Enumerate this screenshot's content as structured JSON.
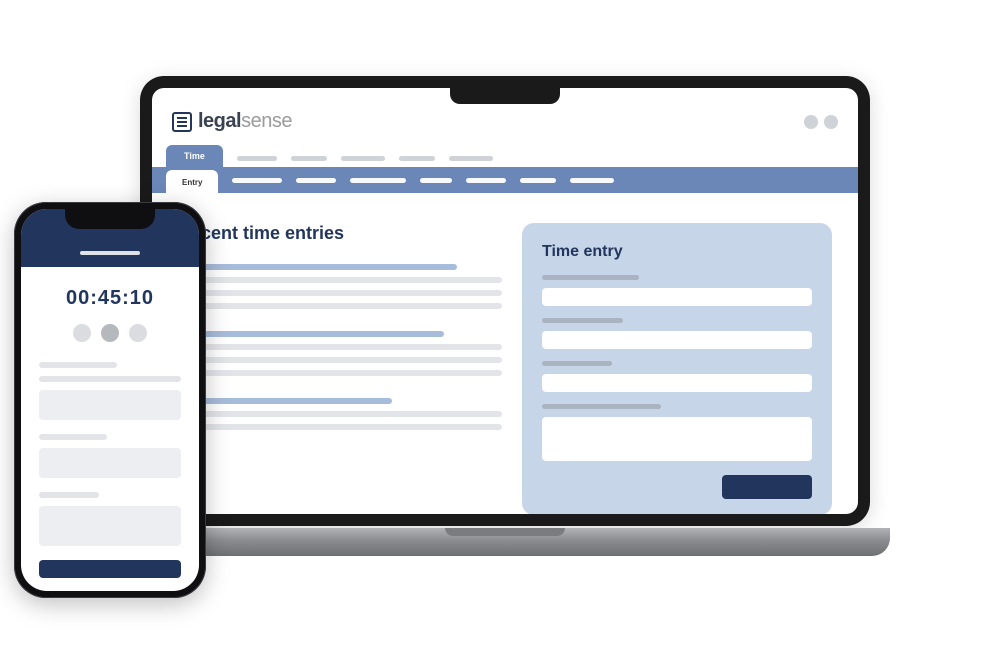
{
  "brand": {
    "logo_bold": "legal",
    "logo_light": "sense"
  },
  "nav": {
    "primary_active": "Time",
    "secondary_active": "Entry"
  },
  "desktop": {
    "recent_heading": "Recent time entries",
    "form_heading": "Time entry"
  },
  "mobile": {
    "timer": "00:45:10"
  }
}
